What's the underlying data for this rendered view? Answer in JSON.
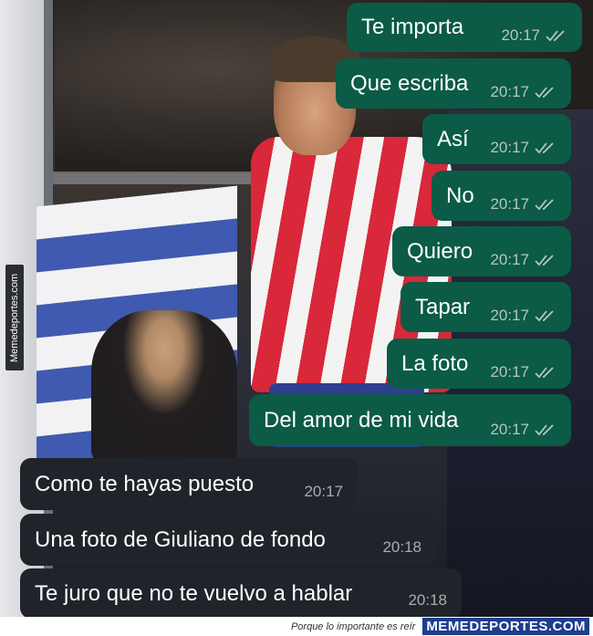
{
  "watermark": "Memedeportes.com",
  "outgoing_messages": [
    {
      "text": "Te importa",
      "time": "20:17"
    },
    {
      "text": "Que escriba",
      "time": "20:17"
    },
    {
      "text": "Así",
      "time": "20:17"
    },
    {
      "text": "No",
      "time": "20:17"
    },
    {
      "text": "Quiero",
      "time": "20:17"
    },
    {
      "text": "Tapar",
      "time": "20:17"
    },
    {
      "text": "La foto",
      "time": "20:17"
    },
    {
      "text": "Del amor de mi vida",
      "time": "20:17"
    }
  ],
  "incoming_messages": [
    {
      "text": "Como te hayas puesto",
      "time": "20:17"
    },
    {
      "text": "Una foto de Giuliano de fondo",
      "time": "20:18"
    },
    {
      "text": "Te juro que no te vuelvo a hablar",
      "time": "20:18"
    }
  ],
  "footer": {
    "tagline": "Porque lo importante es reír",
    "brand": "MEMEDEPORTES.COM"
  },
  "colors": {
    "outgoing_bubble": "#0b5b46",
    "incoming_bubble": "#20242a",
    "brand": "#1e3d8f"
  }
}
